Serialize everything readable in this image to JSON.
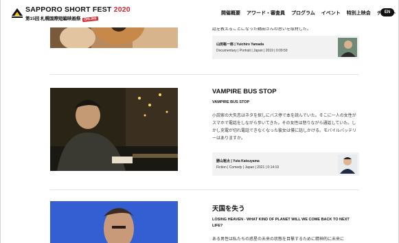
{
  "header": {
    "logo_title": "SAPPORO SHORT FEST",
    "logo_year": "2020",
    "logo_subtitle": "第15回 札幌国際短編映画祭",
    "logo_badge": "ONLINE",
    "nav": [
      "開催概要",
      "アワード・審査員",
      "プログラム",
      "イベント",
      "特別上映会",
      "チケット"
    ],
    "lang_button": "EN"
  },
  "films": [
    {
      "desc_tail": "話を教えることになった鶴田さんの思いを取材した。",
      "credit_name": "山田裕一郎 | Yuichiro Yamada",
      "credit_meta": "Documentary | Portrait | Japan | 2019 | 0:09:59"
    },
    {
      "title": "VAMPIRE BUS STOP",
      "subtitle": "VAMPIRE BUS STOP",
      "description": "小説家の大失恋はネタを探しにバス停で本を読んでいた。そこに一人の女性がスマホで電話をしながら歩いてきた。その女性は怒りながら通話していた。しかし充電が切れ電話できなくなった彼女は僕に話しかける。モバイルバッテリーはありますか。",
      "credit_name": "勝山裕太 | Yuta Katsuyama",
      "credit_meta": "Fiction | Comedy | Japan | 2021 | 0:14:19"
    },
    {
      "title": "天国を失う",
      "subtitle": "LOSING HEAVEN - WHAT KIND OF PLANET WILL WE COME BACK TO NEXT LIFE?",
      "description": "ある男性は私たちの惑星の未来の状態を目撃するために精神的に未来に"
    }
  ]
}
